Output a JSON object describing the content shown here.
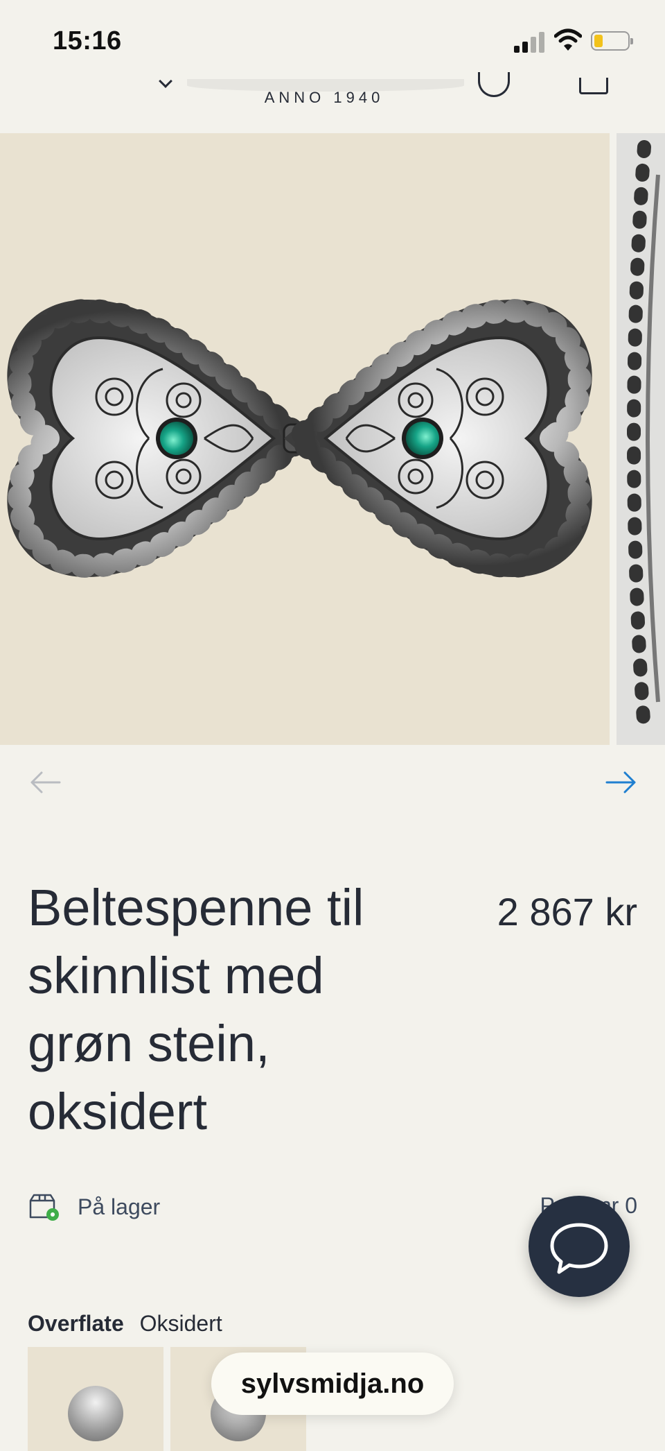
{
  "status_bar": {
    "time": "15:16"
  },
  "header": {
    "brand_subtitle": "ANNO 1940"
  },
  "product": {
    "title": "Beltespenne til skinnlist med grøn stein, oksidert",
    "price": "2 867 kr",
    "stock_status": "På lager",
    "product_number_label": "Prod. nr",
    "product_number": "0"
  },
  "variant": {
    "label": "Overflate",
    "value": "Oksidert"
  },
  "browser": {
    "url": "sylvsmidja.no"
  },
  "colors": {
    "background": "#f3f2ec",
    "image_background": "#e9e2d1",
    "text": "#262b36",
    "accent_blue": "#1f7fd0",
    "stone_green": "#16a487",
    "chat_button": "#263041",
    "stock_green": "#3fae49"
  },
  "icons": {
    "prev": "arrow-left-icon",
    "next": "arrow-right-icon",
    "stock": "package-check-icon",
    "chat": "chat-bubble-icon"
  }
}
